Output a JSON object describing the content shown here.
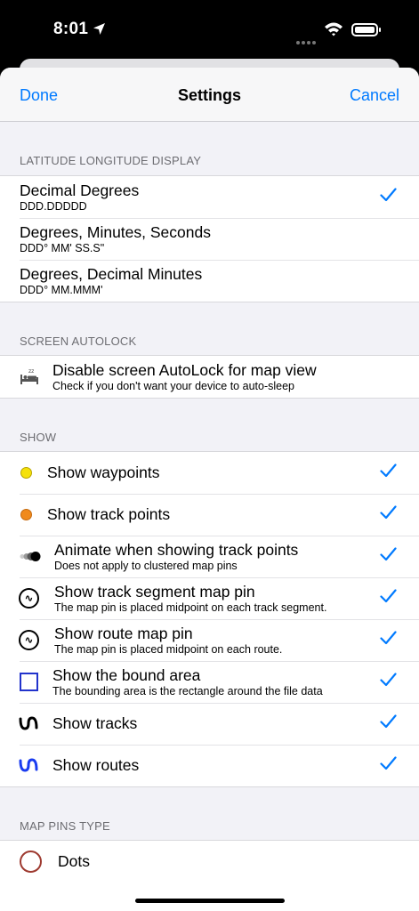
{
  "status": {
    "time": "8:01"
  },
  "nav": {
    "done": "Done",
    "title": "Settings",
    "cancel": "Cancel"
  },
  "colors": {
    "accent": "#007aff",
    "waypoint": "#f5e10a",
    "track_point": "#f08a1c",
    "bound": "#2233cc",
    "routes": "#1a3cf0",
    "dots_ring": "#9e3a30"
  },
  "latlon": {
    "header": "LATITUDE LONGITUDE DISPLAY",
    "options": [
      {
        "title": "Decimal Degrees",
        "sub": "DDD.DDDDD",
        "checked": true
      },
      {
        "title": "Degrees, Minutes, Seconds",
        "sub": "DDD° MM' SS.S\"",
        "checked": false
      },
      {
        "title": "Degrees, Decimal Minutes",
        "sub": "DDD° MM.MMM'",
        "checked": false
      }
    ]
  },
  "autolock": {
    "header": "SCREEN AUTOLOCK",
    "title": "Disable screen AutoLock for map view",
    "sub": "Check if you don't want your device to auto-sleep",
    "icon": "bed-sleep-icon"
  },
  "show": {
    "header": "SHOW",
    "items": [
      {
        "title": "Show waypoints",
        "icon": "yellow-dot-icon",
        "checked": true
      },
      {
        "title": "Show track points",
        "icon": "orange-dot-icon",
        "checked": true
      },
      {
        "title": "Animate when showing track points",
        "sub": "Does not apply to clustered map pins",
        "icon": "animated-dots-icon",
        "checked": true
      },
      {
        "title": "Show track segment map pin",
        "sub": "The map pin is placed midpoint on each track segment.",
        "icon": "track-pin-icon",
        "checked": true
      },
      {
        "title": "Show route map pin",
        "sub": "The map pin is placed midpoint on each route.",
        "icon": "route-pin-icon",
        "checked": true
      },
      {
        "title": "Show the bound area",
        "sub": "The bounding area is the rectangle around the file data",
        "icon": "bound-square-icon",
        "checked": true
      },
      {
        "title": "Show tracks",
        "icon": "tracks-icon",
        "checked": true
      },
      {
        "title": "Show routes",
        "icon": "routes-icon",
        "checked": true
      }
    ]
  },
  "pins": {
    "header": "MAP PINS TYPE",
    "options": [
      {
        "title": "Dots",
        "icon": "ring-icon"
      }
    ]
  }
}
